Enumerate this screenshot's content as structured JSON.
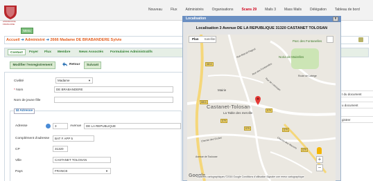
{
  "app": {
    "logo_text": "ASSURANCE FRANCAISE",
    "menu_label": "Menu",
    "top_nav": [
      {
        "label": "Nouveau",
        "alert": false
      },
      {
        "label": "Flux",
        "alert": false
      },
      {
        "label": "Administrés",
        "alert": false
      },
      {
        "label": "Organisations",
        "alert": false
      },
      {
        "label": "Scans 29",
        "alert": true
      },
      {
        "label": "Mails 3",
        "alert": false
      },
      {
        "label": "Mass Mails",
        "alert": false
      },
      {
        "label": "Délégation",
        "alert": false
      },
      {
        "label": "Tableau de bord",
        "alert": false
      }
    ]
  },
  "breadcrumb": {
    "home": "Accueil",
    "section": "Administré",
    "record": "2666 Madame DE BRABANDERE Sylvie"
  },
  "tabs": [
    "Contact",
    "Foyer",
    "Flux",
    "Membre",
    "News Assoctés",
    "Formulaires Administratifs"
  ],
  "actions": {
    "modify": "Modifier l'enregistrement",
    "retour": "Retour",
    "suivant": "Suivant"
  },
  "form": {
    "civilite_label": "Civilité",
    "civilite_value": "Madame",
    "nom_label": "Nom",
    "nom_value": "DE BRABANDERE",
    "nom_jeune_fille_label": "Nom de jeune fille",
    "nom_jeune_fille_value": "",
    "adresse_legend": "Adresse",
    "adresse_label": "Adresse",
    "numero_value": "3",
    "voie_type": "Avenue",
    "voie_value": "DE LA REPUBLIQUE",
    "complement_label": "Complément d'adresse",
    "complement_value": "BAT F APP 5",
    "cp_label": "CP",
    "cp_value": "31320",
    "ville_label": "Ville",
    "ville_value": "CASTANET TOLOSAN",
    "pays_label": "Pays",
    "pays_value": "FRANCE"
  },
  "right_panel": {
    "rows": [
      "t du document",
      "u document",
      "gistrer"
    ]
  },
  "popup": {
    "title": "Localisation",
    "close": "x",
    "heading": "Localisation 3 Avenue DE LA REPUBLIQUE 31320 CASTANET TOLOSAN",
    "map_type_on": "Plan",
    "map_type_off": "Satellite",
    "zoom_in": "+",
    "zoom_out": "−",
    "google": "Google",
    "footer": "Données cartographiques ©2016 Google   Conditions d'utilisation   Signaler une erreur cartographique",
    "town_label": "Castanet-Tolosan",
    "poi_label": "La Table des merville",
    "mairie_label": "Mairie",
    "park_label": "Parc des Fontanelles",
    "noria_label": "Noria de Mairelles",
    "roads": [
      "Rue Marcel Pagnol",
      "Rue des Fontanelles",
      "Route de Labège",
      "Chemin des Ecoles",
      "Rue de Lassoupe",
      "Chemin des Mauves",
      "Avenue de Toulouse"
    ],
    "road_badges": [
      "D813",
      "D79",
      "D813",
      "D79",
      "D79",
      "D79",
      "D79"
    ]
  }
}
